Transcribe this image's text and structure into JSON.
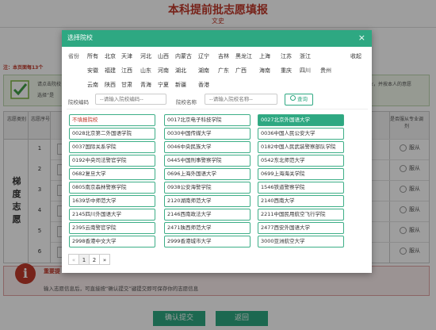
{
  "page": {
    "title": "本科提前批志愿填报",
    "subtitle": "文史",
    "note": "注：本页面每13个",
    "info_line1": "请点击院校",
    "info_line2": "选择“是",
    "info_line3": "业，并按本人的意愿",
    "table": {
      "col1": "志愿类别",
      "col2": "志愿序号",
      "col3": "是否服从专业调剂",
      "group_label": "梯度志愿",
      "rows": [
        "1",
        "2",
        "3",
        "4",
        "5",
        "6"
      ],
      "radio_label": "服从"
    },
    "important_label": "重要提",
    "bottom_text": "输入志愿信息后，可直接按“确认提交”键提交即可保存你的志愿信息",
    "submit_button": "确认提交",
    "back_button": "返回"
  },
  "modal": {
    "title": "选择院校",
    "close_icon": "×",
    "province_label": "省份",
    "provinces_row1": [
      "所有",
      "北京",
      "天津",
      "河北",
      "山西",
      "内蒙古",
      "辽宁",
      "吉林",
      "黑龙江",
      "上海",
      "江苏",
      "浙江"
    ],
    "provinces_row2": [
      "安徽",
      "福建",
      "江西",
      "山东",
      "河南",
      "湖北",
      "湖南",
      "广东",
      "广西",
      "海南",
      "重庆",
      "四川",
      "贵州"
    ],
    "provinces_row3": [
      "云南",
      "陕西",
      "甘肃",
      "青海",
      "宁夏",
      "新疆",
      "香港"
    ],
    "collapse_label": "收起",
    "code_label": "院校编码",
    "code_placeholder": "--请输入院校编码--",
    "name_label": "院校名称",
    "name_placeholder": "--请输入院校名称--",
    "search_button": "查询",
    "schools": [
      "不填报院校",
      "0017北京电子科技学院",
      "0027北京外国语大学",
      "0028北京第二外国语学院",
      "0030中国传媒大学",
      "0036中国人民公安大学",
      "0037国际关系学院",
      "0046中央民族大学",
      "0182中国人民武装警察部队学院",
      "0192中央司法警官学院",
      "0445中国刑事警察学院",
      "0542东北师范大学",
      "0682复旦大学",
      "0696上海外国语大学",
      "0699上海海关学院",
      "0805南京森林警察学院",
      "0938公安海警学院",
      "1546铁道警察学院",
      "1639华中师范大学",
      "2120湖南师范大学",
      "2140西南大学",
      "2145四川外国语大学",
      "2146西南政法大学",
      "2211中国民用航空飞行学院",
      "2395云南警官学院",
      "2471陕西师范大学",
      "2477西安外国语大学",
      "2998香港中文大学",
      "2999香港城市大学",
      "3000亚洲航空大学"
    ],
    "pagination": [
      "«",
      "1",
      "2",
      "»"
    ]
  },
  "colors": {
    "accent": "#2ea882",
    "danger": "#c0392b"
  }
}
